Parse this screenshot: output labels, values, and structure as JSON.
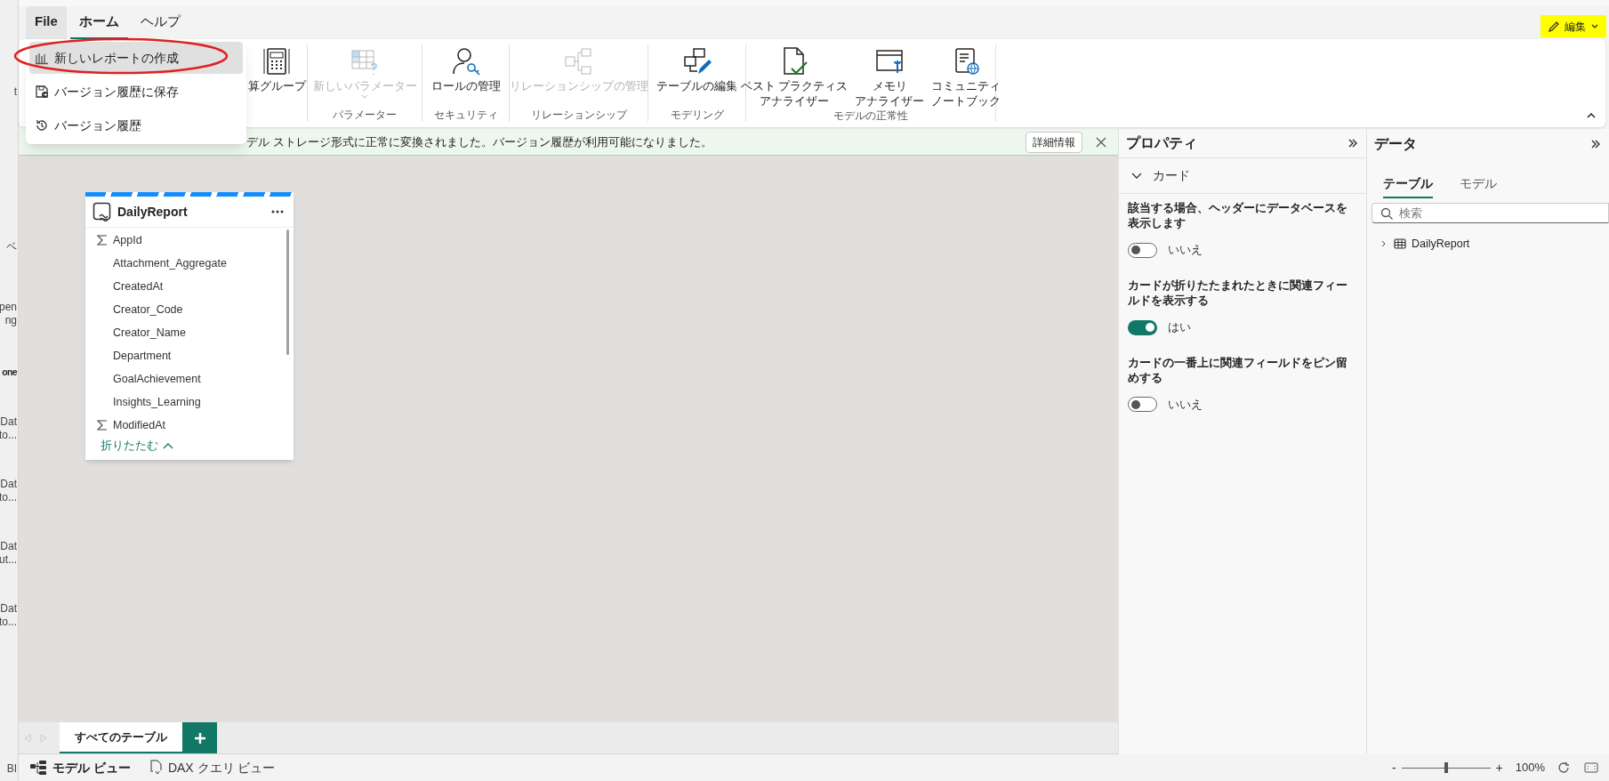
{
  "left_strip": [
    {
      "lines": [
        "t"
      ],
      "bold": false
    },
    {
      "lines": [
        "ベ"
      ],
      "bold": false
    },
    {
      "lines": [
        "pen",
        "ng"
      ],
      "bold": false
    },
    {
      "lines": [
        "one"
      ],
      "bold": true
    },
    {
      "lines": [
        "Dat",
        "to..."
      ],
      "bold": false
    },
    {
      "lines": [
        "Dat",
        "to..."
      ],
      "bold": false
    },
    {
      "lines": [
        "Dat",
        "ut..."
      ],
      "bold": false
    },
    {
      "lines": [
        "Dat",
        "to..."
      ],
      "bold": false
    },
    {
      "lines": [
        "BI"
      ],
      "bold": false
    }
  ],
  "menu_tabs": [
    {
      "label": "File",
      "selected": false,
      "open": true
    },
    {
      "label": "ホーム",
      "selected": true,
      "open": false
    },
    {
      "label": "ヘルプ",
      "selected": false,
      "open": false
    }
  ],
  "edit_button": {
    "label": "編集",
    "highlighted": true
  },
  "file_menu": {
    "items": [
      {
        "label": "新しいレポートの作成",
        "kind": "report",
        "selected": true,
        "circled": true
      },
      {
        "label": "バージョン履歴に保存",
        "kind": "save",
        "selected": false,
        "circled": false
      },
      {
        "label": "バージョン履歴",
        "kind": "history",
        "selected": false,
        "circled": false
      }
    ]
  },
  "ribbon": {
    "groups": [
      {
        "items": [
          {
            "lines": [
              "算グループ"
            ],
            "kind": "calculator",
            "disabled": false,
            "dropdown": false
          }
        ]
      },
      {
        "label": "パラメーター",
        "items": [
          {
            "lines": [
              "新しいパラメーター"
            ],
            "kind": "parameter",
            "disabled": true,
            "dropdown": true
          }
        ]
      },
      {
        "label": "セキュリティ",
        "items": [
          {
            "lines": [
              "ロールの管理"
            ],
            "kind": "role",
            "disabled": false,
            "dropdown": false
          }
        ]
      },
      {
        "label": "リレーションシップ",
        "items": [
          {
            "lines": [
              "リレーションシップの管理"
            ],
            "kind": "relationship",
            "disabled": true,
            "dropdown": false
          }
        ]
      },
      {
        "label": "モデリング",
        "items": [
          {
            "lines": [
              "テーブルの編集"
            ],
            "kind": "edit_tables",
            "disabled": false,
            "dropdown": false
          }
        ]
      },
      {
        "label": "モデルの正常性",
        "items": [
          {
            "lines": [
              "ベスト プラクティス",
              "アナライザー"
            ],
            "kind": "best_practice",
            "disabled": false,
            "dropdown": false
          },
          {
            "lines": [
              "メモリ",
              "アナライザー"
            ],
            "kind": "memory",
            "disabled": false,
            "dropdown": false
          },
          {
            "lines": [
              "コミュニティ",
              "ノートブック"
            ],
            "kind": "notebook",
            "disabled": false,
            "dropdown": false
          }
        ]
      }
    ]
  },
  "notification": {
    "message": "デル ストレージ形式に正常に変換されました。バージョン履歴が利用可能になりました。",
    "details_button": "詳細情報"
  },
  "canvas": {
    "cards": [
      {
        "title": "DailyReport",
        "fields": [
          {
            "name": "AppId",
            "summarized": true
          },
          {
            "name": "Attachment_Aggregate",
            "summarized": false
          },
          {
            "name": "CreatedAt",
            "summarized": false
          },
          {
            "name": "Creator_Code",
            "summarized": false
          },
          {
            "name": "Creator_Name",
            "summarized": false
          },
          {
            "name": "Department",
            "summarized": false
          },
          {
            "name": "GoalAchievement",
            "summarized": false
          },
          {
            "name": "Insights_Learning",
            "summarized": false
          },
          {
            "name": "ModifiedAt",
            "summarized": true
          }
        ],
        "collapse_link": "折りたたむ"
      }
    ]
  },
  "sheet_tabs": [
    {
      "label": "すべてのテーブル",
      "selected": true
    }
  ],
  "properties": {
    "title": "プロパティ",
    "section": {
      "title": "カード",
      "expanded": true
    },
    "settings": [
      {
        "label": "該当する場合、ヘッダーにデータベースを表示します",
        "on": false,
        "value_label": "いいえ"
      },
      {
        "label": "カードが折りたたまれたときに関連フィールドを表示する",
        "on": true,
        "value_label": "はい"
      },
      {
        "label": "カードの一番上に関連フィールドをピン留めする",
        "on": false,
        "value_label": "いいえ"
      }
    ]
  },
  "data_panel": {
    "title": "データ",
    "tabs": [
      {
        "label": "テーブル",
        "selected": true
      },
      {
        "label": "モデル",
        "selected": false
      }
    ],
    "search": {
      "placeholder": "検索"
    },
    "tree": [
      {
        "label": "DailyReport",
        "expanded": false
      }
    ]
  },
  "status_bar": {
    "views": [
      {
        "label": "モデル ビュー",
        "kind": "model",
        "selected": true
      },
      {
        "label": "DAX クエリ ビュー",
        "kind": "dax",
        "selected": false
      }
    ],
    "zoom": {
      "minus": "-",
      "plus": "+",
      "level": 0.5,
      "reading": "100%"
    }
  }
}
